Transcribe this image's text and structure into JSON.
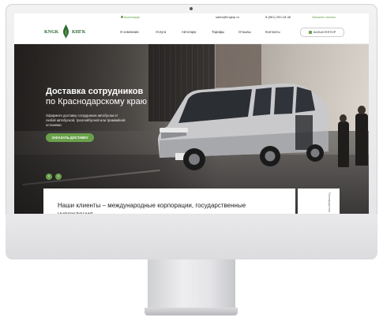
{
  "topbar": {
    "city": "Краснодар",
    "email": "sales@kngkrp.ru",
    "phone": "8 (861) 200-18-48",
    "callback": "Заказать звонок"
  },
  "logo": {
    "left_text": "KNGK",
    "right_text": "КНГК"
  },
  "nav": {
    "items": [
      "О компании",
      "Услуги",
      "Автопарк",
      "Тарифы",
      "Отзывы",
      "Контакты"
    ],
    "calc_label": "КАЛЬКУЛЯТОР"
  },
  "hero": {
    "title_line1": "Доставка сотрудников",
    "title_line2": "по Краснодарскому краю",
    "description": "Оформите доставку сотрудников автобусом от любой автобусной, троллейбусной или трамвайной остановки",
    "order_button": "ЗАКАЗАТЬ ДОСТАВКУ",
    "prev_icon": "‹",
    "next_icon": "›"
  },
  "clients": {
    "title": "Наши клиенты – международные корпорации, государственные учреждения",
    "side_label": "Преимущества"
  },
  "colors": {
    "accent": "#6aa04b",
    "logo": "#2e6b35"
  }
}
